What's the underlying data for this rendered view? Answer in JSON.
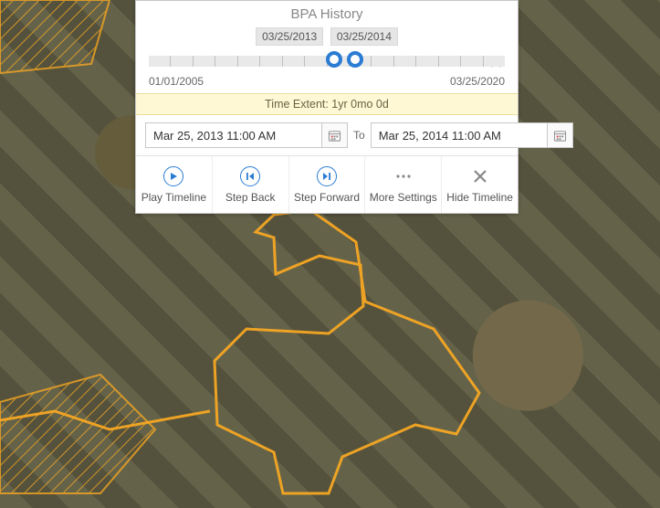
{
  "panel": {
    "title": "BPA History",
    "badges": {
      "start": "03/25/2013",
      "end": "03/25/2014"
    },
    "range": {
      "min_label": "01/01/2005",
      "max_label": "03/25/2020"
    },
    "slider": {
      "ticks": 16,
      "handle_a_pct": 52,
      "handle_b_pct": 58
    },
    "extent_text": "Time Extent: 1yr 0mo 0d",
    "from_value": "Mar 25, 2013 11:00 AM",
    "to_label": "To",
    "to_value": "Mar 25, 2014 11:00 AM",
    "buttons": {
      "play": "Play Timeline",
      "back": "Step Back",
      "fwd": "Step Forward",
      "more": "More Settings",
      "hide": "Hide Timeline"
    }
  },
  "map": {
    "overlay_stroke": "#f5a623"
  }
}
